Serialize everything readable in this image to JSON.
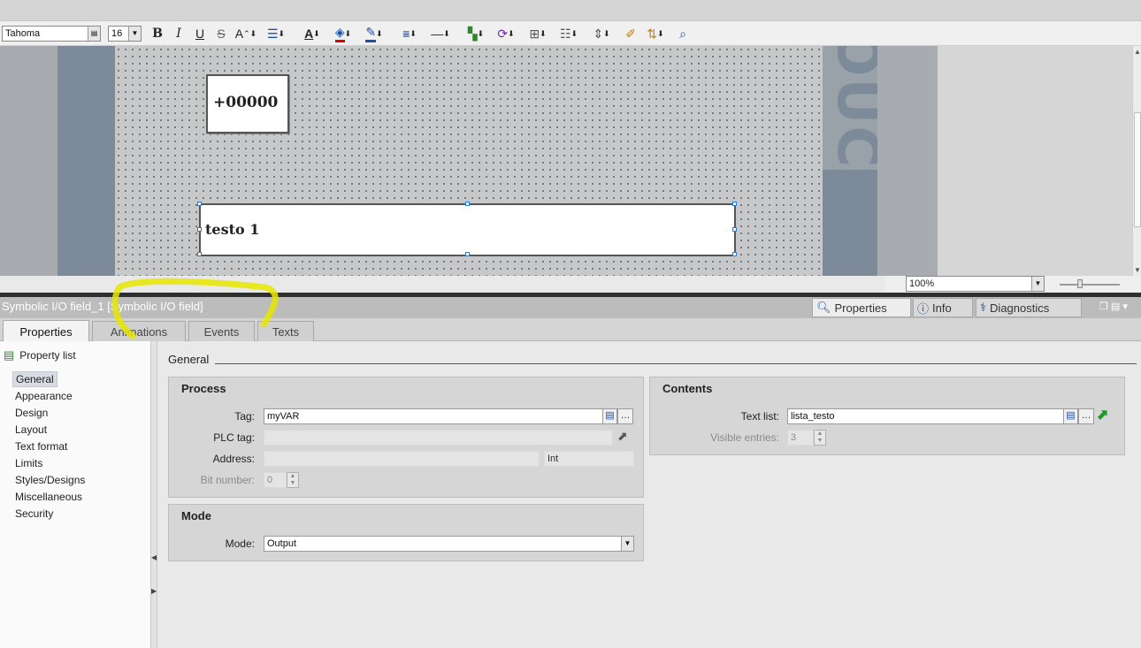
{
  "toolbar": {
    "font_name": "Tahoma",
    "font_size": "16",
    "bold": "B",
    "italic": "I",
    "underline": "U",
    "strike": "S"
  },
  "canvas": {
    "io_field_value": "+00000",
    "symbolic_field_value": "testo 1",
    "side_text": "OUCH",
    "zoom": "100%"
  },
  "properties_header": {
    "title": "Symbolic I/O field_1 [Symbolic I/O field]",
    "right_tabs": [
      "Properties",
      "Info",
      "Diagnostics"
    ]
  },
  "tabs": [
    "Properties",
    "Animations",
    "Events",
    "Texts"
  ],
  "property_list": {
    "header": "Property list",
    "items": [
      "General",
      "Appearance",
      "Design",
      "Layout",
      "Text format",
      "Limits",
      "Styles/Designs",
      "Miscellaneous",
      "Security"
    ],
    "selected": "General"
  },
  "general": {
    "section_label": "General",
    "process": {
      "title": "Process",
      "tag_label": "Tag:",
      "tag_value": "myVAR",
      "plc_tag_label": "PLC tag:",
      "plc_tag_value": "",
      "address_label": "Address:",
      "address_value": "",
      "address_type": "Int",
      "bit_number_label": "Bit number:",
      "bit_number_value": "0"
    },
    "mode": {
      "title": "Mode",
      "mode_label": "Mode:",
      "mode_value": "Output"
    },
    "contents": {
      "title": "Contents",
      "text_list_label": "Text list:",
      "text_list_value": "lista_testo",
      "visible_entries_label": "Visible entries:",
      "visible_entries_value": "3"
    }
  },
  "colors": {
    "highlight": "#e6e600",
    "screen_accent": "#7c8a99",
    "selection_handle": "#2a7ad6"
  }
}
